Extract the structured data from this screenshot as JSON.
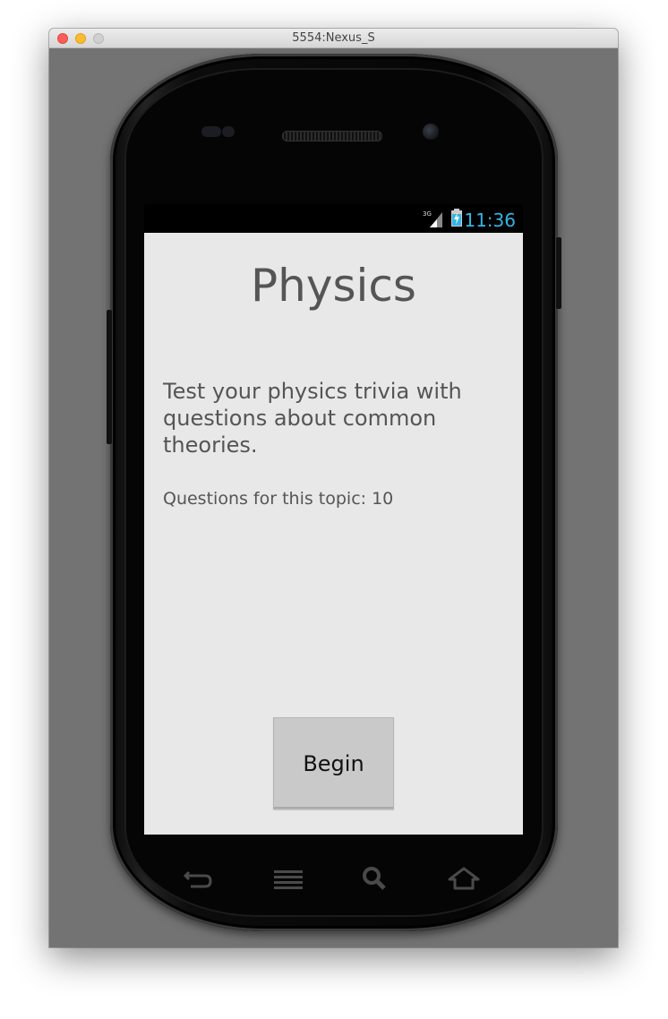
{
  "window": {
    "title": "5554:Nexus_S"
  },
  "statusbar": {
    "network_type": "3G",
    "time": "11:36",
    "time_color": "#33b5e5"
  },
  "screen": {
    "topic_title": "Physics",
    "description": "Test your physics trivia with questions about common theories.",
    "question_count_label": "Questions for this topic: 10",
    "begin_button_label": "Begin"
  },
  "nav": {
    "icons": [
      "back-icon",
      "menu-icon",
      "search-icon",
      "home-icon"
    ]
  }
}
